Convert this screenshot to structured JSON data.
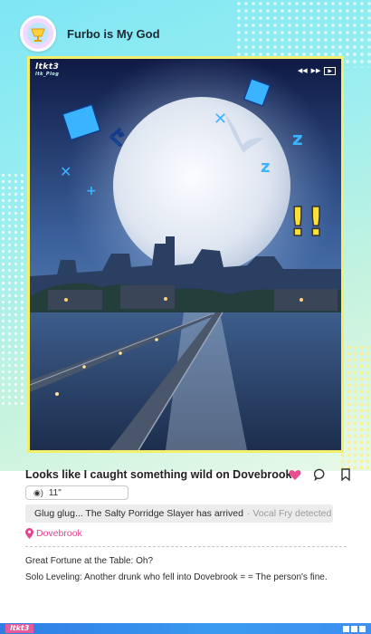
{
  "header": {
    "channel_name": "Furbo is My God"
  },
  "media": {
    "brand_logo": "ltkt3",
    "brand_sub": "ltk_Plog",
    "player_controls": [
      "◀◀",
      "▶▶",
      "▶"
    ],
    "colors": {
      "frame_border": "#f4ef6a",
      "moon": "#e8eef8",
      "accent_blue": "#3bb4ff",
      "accent_yellow": "#ffe033"
    }
  },
  "post": {
    "title": "Looks like I caught something wild on Dovebrook",
    "voice_duration": "11\"",
    "comment_main": "Glug glug... The Salty Porridge Slayer has arrived",
    "comment_tag": "· Vocal Fry detected",
    "location": "Dovebrook",
    "line1": "Great Fortune at the Table: Oh?",
    "line2": "Solo Leveling: Another drunk who fell into Dovebrook = = The person's fine.",
    "icons": [
      "heart-icon",
      "comment-icon",
      "bookmark-icon"
    ],
    "colors": {
      "heart": "#e94d8f",
      "location": "#e0478f"
    }
  },
  "footer": {
    "logo": "ltkt3"
  }
}
